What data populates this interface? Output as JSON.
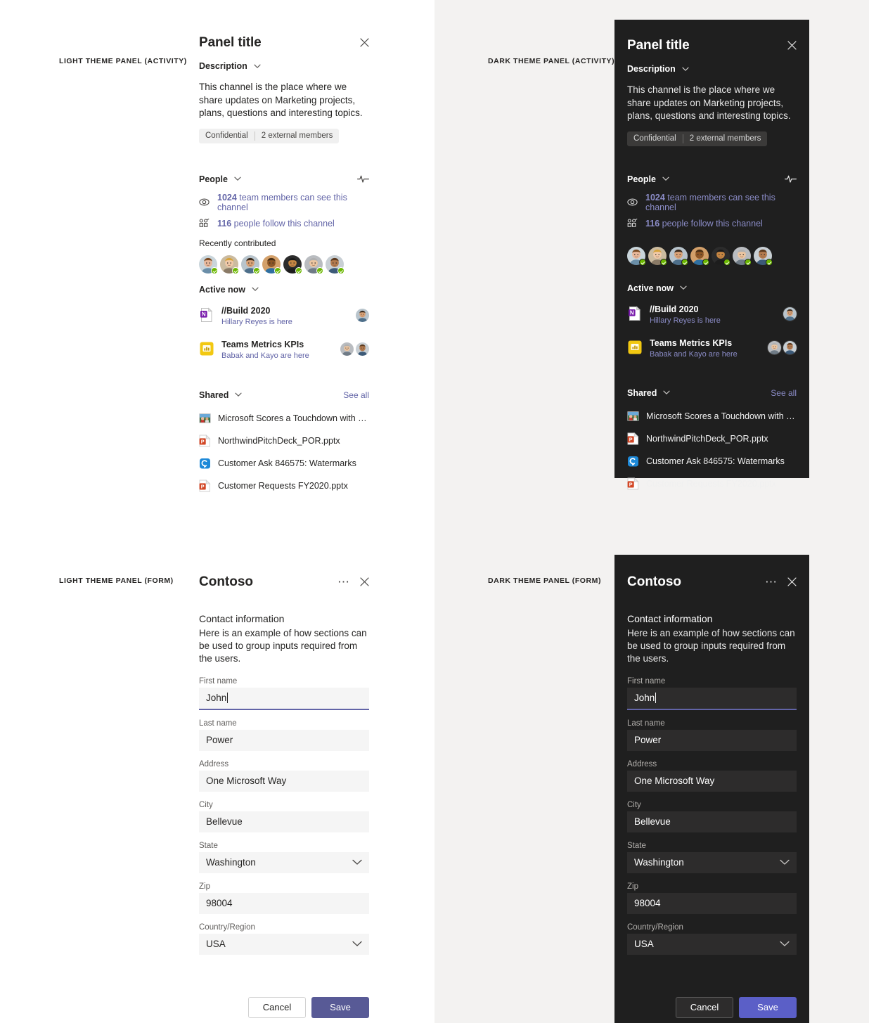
{
  "captions": {
    "light_activity": "LIGHT THEME PANEL (ACTIVITY)",
    "dark_activity": "DARK THEME PANEL (ACTIVITY)",
    "light_form": "LIGHT THEME PANEL (FORM)",
    "dark_form": "DARK THEME PANEL (FORM)"
  },
  "colors": {
    "accent": "#6264a7",
    "accent_button": "#5b5fc7",
    "link_light": "#6264a7",
    "link_dark": "#8b8cc7",
    "presence_available": "#6bb700",
    "panel_dark_bg": "#1f1f1f",
    "panel_light_bg": "#ffffff",
    "page_right_bg": "#f3f2f1",
    "input_light_bg": "#f5f5f5",
    "input_dark_bg": "#2d2c2c"
  },
  "activity_panel": {
    "title": "Panel title",
    "close_label": "Close",
    "description_section": {
      "heading": "Description",
      "body": "This channel is the place where we share updates on Marketing projects, plans, questions and interesting topics.",
      "tags": [
        "Confidential",
        "2 external members"
      ]
    },
    "people_section": {
      "heading": "People",
      "activity_icon": "pulse-icon",
      "links": [
        {
          "count": "1024",
          "text": " team members can see this channel",
          "icon": "eye-icon"
        },
        {
          "count": "116",
          "text": " people follow this channel",
          "icon": "follow-icon"
        }
      ],
      "recently_contributed_label": "Recently contributed",
      "contributors_count": 7
    },
    "active_now_section": {
      "heading": "Active now",
      "items": [
        {
          "icon": "onenote-icon",
          "name": "//Build 2020",
          "subtitle": "Hillary Reyes is here",
          "avatars": 1
        },
        {
          "icon": "powerbi-icon",
          "name": "Teams Metrics KPIs",
          "subtitle": "Babak and Kayo are here",
          "avatars": 2
        }
      ]
    },
    "shared_section": {
      "heading": "Shared",
      "see_all_label": "See all",
      "files": [
        {
          "icon": "image-thumbnail-icon",
          "name": "Microsoft Scores a Touchdown with NF..."
        },
        {
          "icon": "powerpoint-icon",
          "name": "NorthwindPitchDeck_POR.pptx"
        },
        {
          "icon": "yammer-icon",
          "name": "Customer Ask 846575: Watermarks"
        },
        {
          "icon": "powerpoint-icon",
          "name": "Customer Requests FY2020.pptx"
        }
      ]
    }
  },
  "form_panel": {
    "title": "Contoso",
    "more_label": "More options",
    "close_label": "Close",
    "section_heading": "Contact information",
    "section_description": "Here is an example of how sections can be used to group inputs required from the users.",
    "fields": [
      {
        "label": "First name",
        "value": "John",
        "type": "text",
        "focused": true
      },
      {
        "label": "Last name",
        "value": "Power",
        "type": "text",
        "focused": false
      },
      {
        "label": "Address",
        "value": "One Microsoft Way",
        "type": "text",
        "focused": false
      },
      {
        "label": "City",
        "value": "Bellevue",
        "type": "text",
        "focused": false
      },
      {
        "label": "State",
        "value": "Washington",
        "type": "select",
        "focused": false
      },
      {
        "label": "Zip",
        "value": "98004",
        "type": "text",
        "focused": false
      },
      {
        "label": "Country/Region",
        "value": "USA",
        "type": "select",
        "focused": false
      }
    ],
    "buttons": {
      "cancel": "Cancel",
      "save": "Save"
    }
  }
}
